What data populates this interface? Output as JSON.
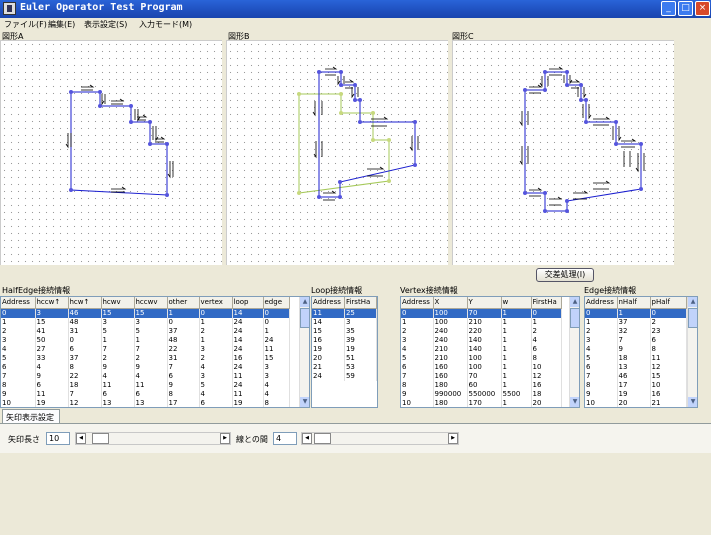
{
  "window": {
    "title": "Euler Operator Test Program",
    "minimize": "_",
    "maximize": "□",
    "close": "×"
  },
  "menu": [
    "ファイル(F)",
    "編集(E)",
    "表示設定(S)",
    "入力モード(M)"
  ],
  "panels": {
    "a": "図形A",
    "b": "図形B",
    "c": "図形C"
  },
  "buttons": {
    "intersect": "交差処理(I)"
  },
  "tables": {
    "halfedge": {
      "title": "HalfEdge接続情報",
      "columns": [
        "Address",
        "hccw↑",
        "hcw↑",
        "hcwv",
        "hccwv",
        "other",
        "vertex",
        "loop",
        "edge"
      ],
      "rows": [
        [
          "0",
          "3",
          "46",
          "15",
          "15",
          "1",
          "0",
          "14",
          "0"
        ],
        [
          "1",
          "15",
          "48",
          "3",
          "3",
          "0",
          "1",
          "24",
          "0"
        ],
        [
          "2",
          "41",
          "31",
          "5",
          "5",
          "37",
          "2",
          "24",
          "1"
        ],
        [
          "3",
          "50",
          "0",
          "1",
          "1",
          "48",
          "1",
          "14",
          "24"
        ],
        [
          "4",
          "27",
          "6",
          "7",
          "7",
          "22",
          "3",
          "24",
          "11"
        ],
        [
          "5",
          "33",
          "37",
          "2",
          "2",
          "31",
          "2",
          "16",
          "15"
        ],
        [
          "6",
          "4",
          "8",
          "9",
          "9",
          "7",
          "4",
          "24",
          "3"
        ],
        [
          "7",
          "9",
          "22",
          "4",
          "4",
          "6",
          "3",
          "11",
          "3"
        ],
        [
          "8",
          "6",
          "18",
          "11",
          "11",
          "9",
          "5",
          "24",
          "4"
        ],
        [
          "9",
          "11",
          "7",
          "6",
          "6",
          "8",
          "4",
          "11",
          "4"
        ],
        [
          "10",
          "19",
          "12",
          "13",
          "13",
          "17",
          "6",
          "19",
          "8"
        ]
      ]
    },
    "loop": {
      "title": "Loop接続情報",
      "columns": [
        "Address",
        "FirstHa"
      ],
      "rows": [
        [
          "11",
          "25"
        ],
        [
          "14",
          "3"
        ],
        [
          "15",
          "35"
        ],
        [
          "16",
          "39"
        ],
        [
          "19",
          "19"
        ],
        [
          "20",
          "51"
        ],
        [
          "21",
          "53"
        ],
        [
          "24",
          "59"
        ]
      ]
    },
    "vertex": {
      "title": "Vertex接続情報",
      "columns": [
        "Address",
        "X",
        "Y",
        "w",
        "FirstHa"
      ],
      "rows": [
        [
          "0",
          "100",
          "70",
          "1",
          "0"
        ],
        [
          "1",
          "100",
          "210",
          "1",
          "1"
        ],
        [
          "2",
          "240",
          "220",
          "1",
          "2"
        ],
        [
          "3",
          "240",
          "140",
          "1",
          "4"
        ],
        [
          "4",
          "210",
          "140",
          "1",
          "6"
        ],
        [
          "5",
          "210",
          "100",
          "1",
          "8"
        ],
        [
          "6",
          "160",
          "100",
          "1",
          "10"
        ],
        [
          "7",
          "160",
          "70",
          "1",
          "12"
        ],
        [
          "8",
          "180",
          "60",
          "1",
          "16"
        ],
        [
          "9",
          "990000",
          "550000",
          "5500",
          "18"
        ],
        [
          "10",
          "180",
          "170",
          "1",
          "20"
        ]
      ]
    },
    "edge": {
      "title": "Edge接続情報",
      "columns": [
        "Address",
        "nHalf",
        "pHalf"
      ],
      "rows": [
        [
          "0",
          "1",
          "0"
        ],
        [
          "1",
          "37",
          "2"
        ],
        [
          "2",
          "32",
          "23"
        ],
        [
          "3",
          "7",
          "6"
        ],
        [
          "4",
          "9",
          "8"
        ],
        [
          "5",
          "18",
          "11"
        ],
        [
          "6",
          "13",
          "12"
        ],
        [
          "7",
          "46",
          "15"
        ],
        [
          "8",
          "17",
          "10"
        ],
        [
          "9",
          "19",
          "16"
        ],
        [
          "10",
          "20",
          "21"
        ]
      ]
    }
  },
  "arrow_settings": {
    "tab": "矢印表示設定",
    "length_label": "矢印長さ",
    "length_value": "10",
    "gap_label": "線との間",
    "gap_value": "4",
    "length_slider_level": 0.05,
    "gap_slider_level": 0.02
  },
  "colors": {
    "polygon": "#1B1FCF",
    "polygon_b": "#A6C95A",
    "selection": "#316AC5"
  }
}
